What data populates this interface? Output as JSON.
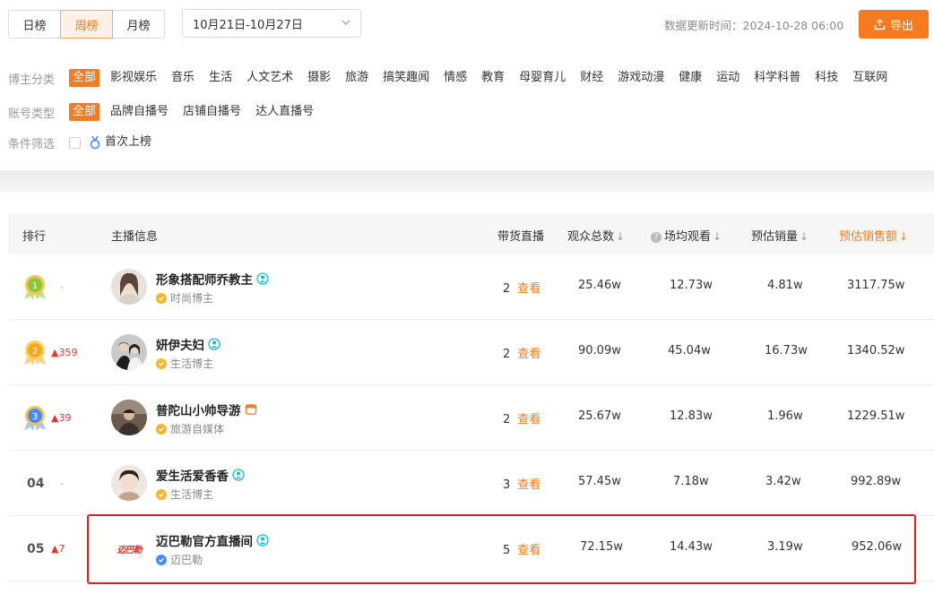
{
  "tabs": [
    {
      "label": "日榜",
      "active": false
    },
    {
      "label": "周榜",
      "active": true
    },
    {
      "label": "月榜",
      "active": false
    }
  ],
  "date_range": "10月21日-10月27日",
  "update_time": "数据更新时间：2024-10-28 06:00",
  "export_label": "导出",
  "filters": {
    "category_label": "博主分类",
    "categories": [
      "全部",
      "影视娱乐",
      "音乐",
      "生活",
      "人文艺术",
      "摄影",
      "旅游",
      "搞笑趣闻",
      "情感",
      "教育",
      "母婴育儿",
      "财经",
      "游戏动漫",
      "健康",
      "运动",
      "科学科普",
      "科技",
      "互联网"
    ],
    "account_label": "账号类型",
    "account_types": [
      "全部",
      "品牌自播号",
      "店铺自播号",
      "达人直播号"
    ],
    "condition_label": "条件筛选",
    "condition_option": "首次上榜"
  },
  "table": {
    "headers": {
      "rank": "排行",
      "anchor": "主播信息",
      "live": "带货直播",
      "viewers": "观众总数",
      "avg_viewers": "场均观看",
      "est_sales": "预估销量",
      "est_revenue": "预估销售额"
    },
    "sort_arrow": "↓",
    "view_label": "查看",
    "rows": [
      {
        "rank": "1",
        "change": "-",
        "name": "形象搭配师乔教主",
        "tag": "时尚博主",
        "live": "2",
        "viewers": "25.46w",
        "avg": "12.73w",
        "sales": "4.81w",
        "revenue": "3117.75w"
      },
      {
        "rank": "2",
        "change": "359",
        "name": "妍伊夫妇",
        "tag": "生活博主",
        "live": "2",
        "viewers": "90.09w",
        "avg": "45.04w",
        "sales": "16.73w",
        "revenue": "1340.52w"
      },
      {
        "rank": "3",
        "change": "39",
        "name": "普陀山小帅导游",
        "tag": "旅游自媒体",
        "live": "2",
        "viewers": "25.67w",
        "avg": "12.83w",
        "sales": "1.96w",
        "revenue": "1229.51w"
      },
      {
        "rank": "04",
        "change": "-",
        "name": "爱生活爱香香",
        "tag": "生活博主",
        "live": "3",
        "viewers": "57.45w",
        "avg": "7.18w",
        "sales": "3.42w",
        "revenue": "992.89w"
      },
      {
        "rank": "05",
        "change": "7",
        "name": "迈巴勒官方直播间",
        "tag": "迈巴勒",
        "logo_text": "迈巴勒",
        "live": "5",
        "viewers": "72.15w",
        "avg": "14.43w",
        "sales": "3.19w",
        "revenue": "952.06w"
      }
    ]
  },
  "colors": {
    "accent": "#f47b20",
    "up": "#e53935",
    "highlight": "#e02020"
  }
}
